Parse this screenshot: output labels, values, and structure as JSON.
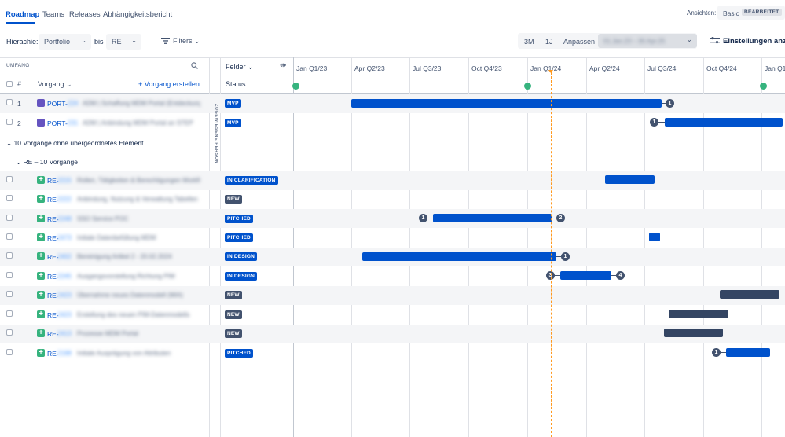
{
  "nav": {
    "tabs": [
      "Roadmap",
      "Teams",
      "Releases",
      "Abhängigkeitsbericht"
    ],
    "view_label": "Ansichten:",
    "view_value": "Basic",
    "view_badge": "BEARBEITET"
  },
  "toolbar": {
    "hierarchy_label": "Hierachie:",
    "hierarchy_from": "Portfolio",
    "to_label": "bis",
    "hierarchy_to": "RE",
    "filters_label": "Filters",
    "zoom_3m": "3M",
    "zoom_1y": "1J",
    "zoom_custom": "Anpassen",
    "date_range": "01.Jan.23 – 30.Apr.25",
    "settings_label": "Einstellungen anzeigen"
  },
  "table_header": {
    "scope_label": "UMFANG",
    "number_label": "#",
    "issue_label": "Vorgang",
    "create_issue": "Vorgang erstellen",
    "fields_label": "Felder",
    "status_label": "Status",
    "assignee_vertical": "ZUGEWIESENE PERSON"
  },
  "timeline": {
    "quarters": [
      "Jan Q1/23",
      "Apr Q2/23",
      "Jul Q3/23",
      "Oct Q4/23",
      "Jan Q1/24",
      "Apr Q2/24",
      "Jul Q3/24",
      "Oct Q4/24",
      "Jan Q1/"
    ]
  },
  "groups": {
    "orphan_label": "10 Vorgänge ohne übergeordnetes Element",
    "re_label": "RE – 10 Vorgänge"
  },
  "epics": [
    {
      "num": "1",
      "key_prefix": "PORT-",
      "key_suffix": "224",
      "summary": "ADM | Schaffung MDM Portal (Entdeckung)",
      "status": "MVP"
    },
    {
      "num": "2",
      "key_prefix": "PORT-",
      "key_suffix": "231",
      "summary": "ADM | Anbindung MDM Portal an STEP",
      "status": "MVP"
    }
  ],
  "stories": [
    {
      "key_prefix": "RE-",
      "key_suffix": "2215",
      "summary": "Rollen, Tätigkeiten & Berechtigungen Workflow",
      "status": "IN CLARIFICATION"
    },
    {
      "key_prefix": "RE-",
      "key_suffix": "2222",
      "summary": "Anbindung, Nutzung & Verwaltung Tabellen",
      "status": "NEW"
    },
    {
      "key_prefix": "RE-",
      "key_suffix": "2248",
      "summary": "SSO Service POC",
      "status": "PITCHED"
    },
    {
      "key_prefix": "RE-",
      "key_suffix": "2473",
      "summary": "Initiale Datenbefüllung MDM",
      "status": "PITCHED"
    },
    {
      "key_prefix": "RE-",
      "key_suffix": "2402",
      "summary": "Bereinigung Artikel 2 - 20.02.2024",
      "status": "IN DESIGN"
    },
    {
      "key_prefix": "RE-",
      "key_suffix": "2245",
      "summary": "Ausgangsvorstellung Richtung PIM",
      "status": "IN DESIGN"
    },
    {
      "key_prefix": "RE-",
      "key_suffix": "2423",
      "summary": "Übernahme neues Datenmodell (MIA)",
      "status": "NEW"
    },
    {
      "key_prefix": "RE-",
      "key_suffix": "2423",
      "summary": "Erstellung des neuen PIM-Datenmodells",
      "status": "NEW"
    },
    {
      "key_prefix": "RE-",
      "key_suffix": "2413",
      "summary": "Prozesse MDM Portal",
      "status": "NEW"
    },
    {
      "key_prefix": "RE-",
      "key_suffix": "2198",
      "summary": "Initiale Ausprägung von Attributen",
      "status": "PITCHED"
    }
  ],
  "dependencies": {
    "epic1_right": "1",
    "epic2_left": "1",
    "story3_left": "1",
    "story3_right": "2",
    "story5_right": "1",
    "story6_left": "3",
    "story6_right": "4",
    "story10_left": "1"
  },
  "colors": {
    "accent": "#0052cc",
    "milestone": "#36b37e",
    "today": "#ff991f",
    "dark_bar": "#344563"
  }
}
